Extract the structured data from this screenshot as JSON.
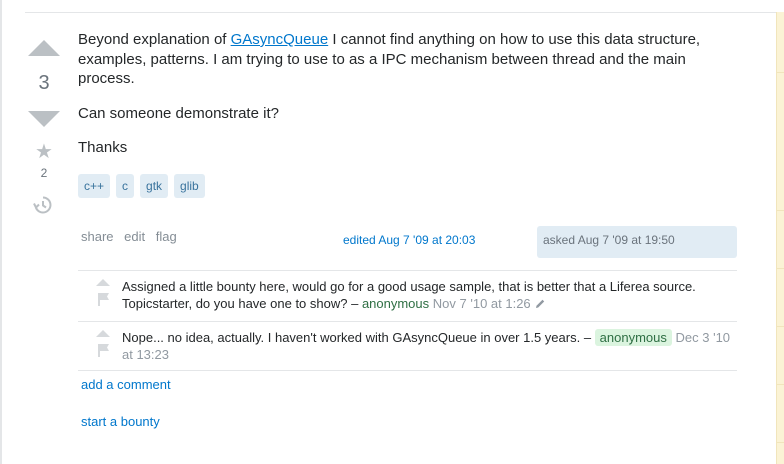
{
  "vote": {
    "count": "3",
    "favorite_count": "2"
  },
  "post": {
    "intro_before_link": "Beyond explanation of ",
    "link_text": "GAsyncQueue",
    "intro_after_link": " I cannot find anything on how to use this data structure, examples, patterns. I am trying to use to as a IPC mechanism between thread and the main process.",
    "question": "Can someone demonstrate it?",
    "thanks": "Thanks"
  },
  "tags": [
    "c++",
    "c",
    "gtk",
    "glib"
  ],
  "menu": {
    "share": "share",
    "edit": "edit",
    "flag": "flag"
  },
  "edited": "edited Aug 7 '09 at 20:03",
  "asked": "asked Aug 7 '09 at 19:50",
  "comments": [
    {
      "text": "Assigned a little bounty here, would go for a good usage sample, that is better that a Liferea source. Topicstarter, do you have one to show? – ",
      "user": "anonymous",
      "date": "Nov 7 '10 at 1:26"
    },
    {
      "text": "Nope... no idea, actually. I haven't worked with GAsyncQueue in over 1.5 years. – ",
      "user": "anonymous",
      "date": "Dec 3 '10 at 13:23"
    }
  ],
  "links": {
    "add_comment": "add a comment",
    "start_bounty": "start a bounty"
  },
  "icons": {
    "vote_up": "vote-up-arrow-icon",
    "vote_down": "vote-down-arrow-icon",
    "favorite": "star-icon",
    "history": "history-icon",
    "comment_upvote": "comment-upvote-icon",
    "comment_flag": "flag-icon",
    "edit": "pencil-icon"
  },
  "colors": {
    "link": "#0077cc",
    "tag_bg": "#e1ecf4",
    "tag_text": "#39739d",
    "user_badge_bg": "#dbf4df",
    "user_text": "#2f6f44"
  }
}
